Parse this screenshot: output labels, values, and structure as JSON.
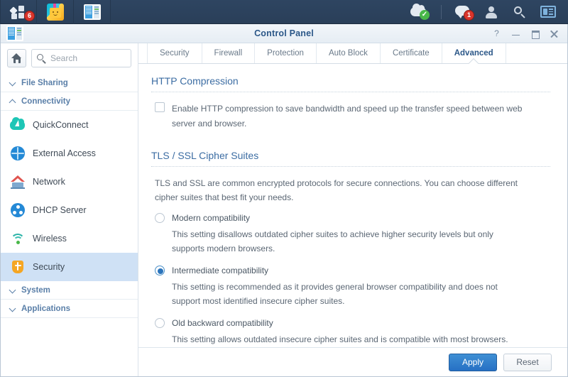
{
  "taskbar": {
    "left_items": [
      {
        "name": "main-menu",
        "icon": "grid-squares-icon",
        "badge": "6"
      },
      {
        "name": "package-center",
        "icon": "package-center-icon",
        "badge": ""
      },
      {
        "name": "control-panel",
        "icon": "control-panel-icon",
        "badge": ""
      }
    ],
    "right_items": [
      {
        "name": "update-status",
        "icon": "cloud-check-icon",
        "badge": "",
        "check": "✓"
      },
      {
        "name": "notifications",
        "icon": "chat-bubble-icon",
        "badge": "1"
      },
      {
        "name": "user-menu",
        "icon": "person-icon",
        "badge": ""
      },
      {
        "name": "search",
        "icon": "search-icon",
        "badge": ""
      },
      {
        "name": "widgets",
        "icon": "widget-panel-icon",
        "badge": ""
      }
    ]
  },
  "window": {
    "title": "Control Panel",
    "controls": {
      "help": "?",
      "minimize": "minimize",
      "maximize": "maximize",
      "close": "close"
    }
  },
  "sidebar": {
    "home_button": "home-icon",
    "search": {
      "placeholder": "Search",
      "value": ""
    },
    "groups": [
      {
        "label": "File Sharing",
        "state": "collapsed"
      },
      {
        "label": "Connectivity",
        "state": "expanded"
      }
    ],
    "items": [
      {
        "label": "QuickConnect",
        "icon": "quickconnect-icon",
        "active": false
      },
      {
        "label": "External Access",
        "icon": "globe-icon",
        "active": false
      },
      {
        "label": "Network",
        "icon": "network-house-icon",
        "active": false
      },
      {
        "label": "DHCP Server",
        "icon": "dhcp-icon",
        "active": false
      },
      {
        "label": "Wireless",
        "icon": "wifi-icon",
        "active": false
      },
      {
        "label": "Security",
        "icon": "shield-icon",
        "active": true
      }
    ],
    "groups_bottom": [
      {
        "label": "System",
        "state": "collapsed"
      },
      {
        "label": "Applications",
        "state": "collapsed"
      }
    ]
  },
  "tabs": [
    {
      "label": "Security",
      "active": false
    },
    {
      "label": "Firewall",
      "active": false
    },
    {
      "label": "Protection",
      "active": false
    },
    {
      "label": "Auto Block",
      "active": false
    },
    {
      "label": "Certificate",
      "active": false
    },
    {
      "label": "Advanced",
      "active": true
    }
  ],
  "main": {
    "http_compression": {
      "title": "HTTP Compression",
      "checkbox_label": "Enable HTTP compression to save bandwidth and speed up the transfer speed between web server and browser.",
      "checked": false
    },
    "cipher_suites": {
      "title": "TLS / SSL Cipher Suites",
      "description": "TLS and SSL are common encrypted protocols for secure connections. You can choose different cipher suites that best fit your needs.",
      "options": [
        {
          "label": "Modern compatibility",
          "description": "This setting disallows outdated cipher suites to achieve higher security levels but only supports modern browsers.",
          "selected": false
        },
        {
          "label": "Intermediate compatibility",
          "description": "This setting is recommended as it provides general browser compatibility and does not support most identified insecure cipher suites.",
          "selected": true
        },
        {
          "label": "Old backward compatibility",
          "description": "This setting allows outdated insecure cipher suites and is compatible with most browsers. Only select this setting if you need to maintain high browser compatibility.",
          "selected": false
        }
      ]
    }
  },
  "footer": {
    "apply_label": "Apply",
    "reset_label": "Reset"
  },
  "colors": {
    "accent_blue": "#2670c4",
    "taskbar": "#2e4561",
    "active_item": "#cfe1f5",
    "badge_red": "#d9352c",
    "shield_orange": "#f5a623",
    "section_title": "#3c6da3"
  }
}
